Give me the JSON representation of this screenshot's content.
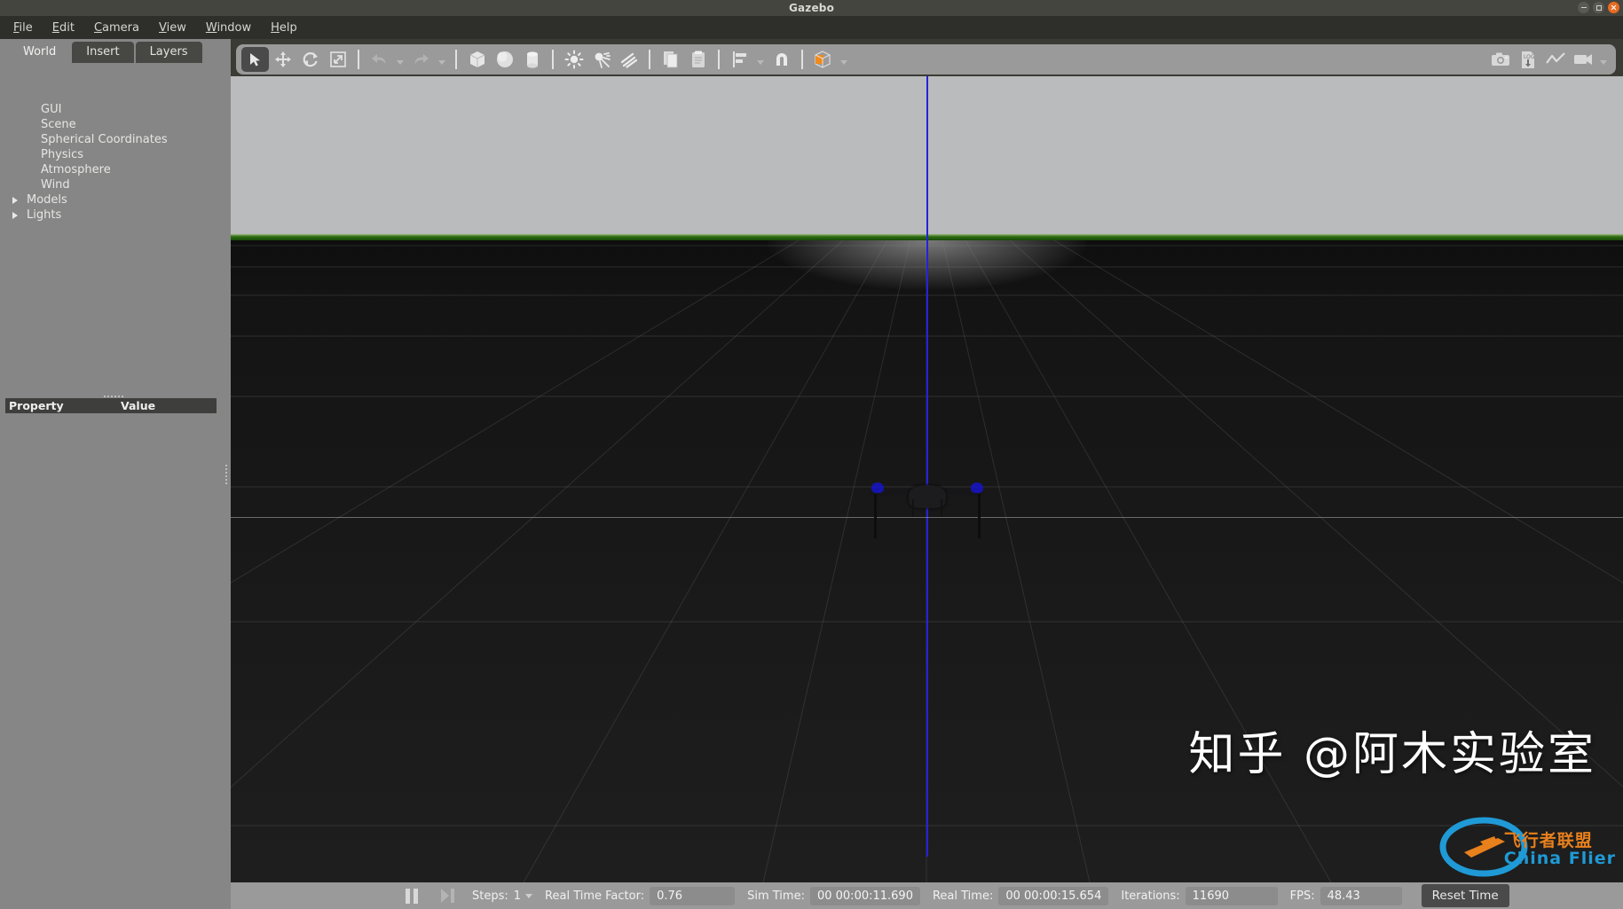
{
  "window": {
    "title": "Gazebo",
    "controls": [
      {
        "name": "minimize-button",
        "glyph": "minimize"
      },
      {
        "name": "maximize-button",
        "glyph": "maximize"
      },
      {
        "name": "close-button",
        "glyph": "close"
      }
    ],
    "accent_close": "#e86a21"
  },
  "menubar": {
    "items": [
      {
        "label": "File",
        "mnemonic": "F",
        "rest": "ile"
      },
      {
        "label": "Edit",
        "mnemonic": "E",
        "rest": "dit"
      },
      {
        "label": "Camera",
        "mnemonic": "C",
        "rest": "amera"
      },
      {
        "label": "View",
        "mnemonic": "V",
        "rest": "iew"
      },
      {
        "label": "Window",
        "mnemonic": "W",
        "rest": "indow"
      },
      {
        "label": "Help",
        "mnemonic": "H",
        "rest": "elp"
      }
    ]
  },
  "left_panel": {
    "tabs": [
      {
        "label": "World",
        "active": true
      },
      {
        "label": "Insert",
        "active": false
      },
      {
        "label": "Layers",
        "active": false
      }
    ],
    "tree": [
      {
        "label": "GUI",
        "expandable": false
      },
      {
        "label": "Scene",
        "expandable": false
      },
      {
        "label": "Spherical Coordinates",
        "expandable": false
      },
      {
        "label": "Physics",
        "expandable": false
      },
      {
        "label": "Atmosphere",
        "expandable": false
      },
      {
        "label": "Wind",
        "expandable": false
      },
      {
        "label": "Models",
        "expandable": true
      },
      {
        "label": "Lights",
        "expandable": true
      }
    ],
    "property_table": {
      "columns": [
        "Property",
        "Value"
      ],
      "rows": []
    }
  },
  "toolbar": {
    "left_tools": [
      {
        "name": "select-mode-icon",
        "label": "Select",
        "active": true
      },
      {
        "name": "translate-mode-icon",
        "label": "Translate Mode",
        "active": false
      },
      {
        "name": "rotate-mode-icon",
        "label": "Rotate Mode",
        "active": false
      },
      {
        "name": "scale-mode-icon",
        "label": "Scale Mode",
        "active": false
      },
      {
        "name": "undo-icon",
        "label": "Undo",
        "active": false
      },
      {
        "name": "redo-icon",
        "label": "Redo",
        "active": false
      },
      {
        "name": "box-icon",
        "label": "Box",
        "active": false
      },
      {
        "name": "sphere-icon",
        "label": "Sphere",
        "active": false
      },
      {
        "name": "cylinder-icon",
        "label": "Cylinder",
        "active": false
      },
      {
        "name": "point-light-icon",
        "label": "Point Light",
        "active": false
      },
      {
        "name": "spot-light-icon",
        "label": "Spot Light",
        "active": false
      },
      {
        "name": "directional-light-icon",
        "label": "Directional Light",
        "active": false
      },
      {
        "name": "copy-icon",
        "label": "Copy",
        "active": false
      },
      {
        "name": "paste-icon",
        "label": "Paste",
        "active": false
      },
      {
        "name": "align-icon",
        "label": "Align",
        "active": false
      },
      {
        "name": "snap-icon",
        "label": "Snap",
        "active": false
      },
      {
        "name": "view-mode-icon",
        "label": "View Mode",
        "active": false
      }
    ],
    "right_tools": [
      {
        "name": "screenshot-icon",
        "label": "Screenshot"
      },
      {
        "name": "log-download-icon",
        "label": "Log"
      },
      {
        "name": "plot-icon",
        "label": "Plot"
      },
      {
        "name": "record-video-icon",
        "label": "Record Video"
      }
    ],
    "highlight_color": "#f08a1e"
  },
  "viewport": {
    "sky_color": "#b9bbbc",
    "horizon_color": "#2f6d13",
    "ground_color": "#161616",
    "axis_color": "#2323d8",
    "model_name": "quadcopter-drone",
    "watermark": "知乎 @阿木实验室",
    "logo": {
      "cn": "飞行者联盟",
      "en": "China Flier",
      "cn_color": "#e8801c",
      "en_color": "#1f9ad6"
    }
  },
  "statusbar": {
    "pause_label": "Pause",
    "step_label": "Step",
    "steps": {
      "label": "Steps:",
      "value": "1"
    },
    "real_time_factor": {
      "label": "Real Time Factor:",
      "value": "0.76"
    },
    "sim_time": {
      "label": "Sim Time:",
      "value": "00 00:00:11.690"
    },
    "real_time": {
      "label": "Real Time:",
      "value": "00 00:00:15.654"
    },
    "iterations": {
      "label": "Iterations:",
      "value": "11690"
    },
    "fps": {
      "label": "FPS:",
      "value": "48.43"
    },
    "reset_button": "Reset Time"
  }
}
